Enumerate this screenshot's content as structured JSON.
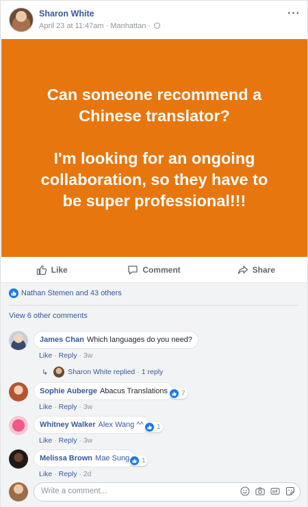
{
  "post": {
    "author": "Sharon White",
    "date": "April 23 at 11:47am",
    "location": "Manhattan",
    "more": "···",
    "banner_lines": [
      "Can someone recommend a",
      "Chinese translator?",
      "I'm looking for an ongoing",
      "collaboration, so they have to",
      "be super professional!!!"
    ],
    "banner_color": "#e8760e"
  },
  "actions": {
    "like": "Like",
    "comment": "Comment",
    "share": "Share"
  },
  "reactions": {
    "text": "Nathan Stemen and 43 others"
  },
  "view_more": "View 6 other comments",
  "comments": [
    {
      "name": "James Chan",
      "text": "Which languages do you need?",
      "like": "Like",
      "reply": "Reply",
      "age": "3w",
      "replied_by": "Sharon White replied",
      "reply_count": "1 reply",
      "reactions": ""
    },
    {
      "name": "Sophie Auberge",
      "text": "Abacus Translations",
      "like": "Like",
      "reply": "Reply",
      "age": "3w",
      "reactions": "7"
    },
    {
      "name": "Whitney Walker",
      "text": "Alex Wang ^^",
      "like": "Like",
      "reply": "Reply",
      "age": "3w",
      "reactions": "1"
    },
    {
      "name": "Melissa Brown",
      "text": "Mae Sung",
      "like": "Like",
      "reply": "Reply",
      "age": "2d",
      "reactions": "1"
    }
  ],
  "write": {
    "placeholder": "Write a comment..."
  },
  "separator": "·",
  "icons": [
    "globe-icon",
    "more-icon",
    "like-icon",
    "comment-icon",
    "share-icon",
    "thumbs-up-badge-icon",
    "reply-arrow-icon",
    "emoji-icon",
    "camera-icon",
    "gif-icon",
    "sticker-icon"
  ],
  "colors": {
    "link": "#365899",
    "accent": "#1877f2",
    "banner": "#e8760e"
  }
}
